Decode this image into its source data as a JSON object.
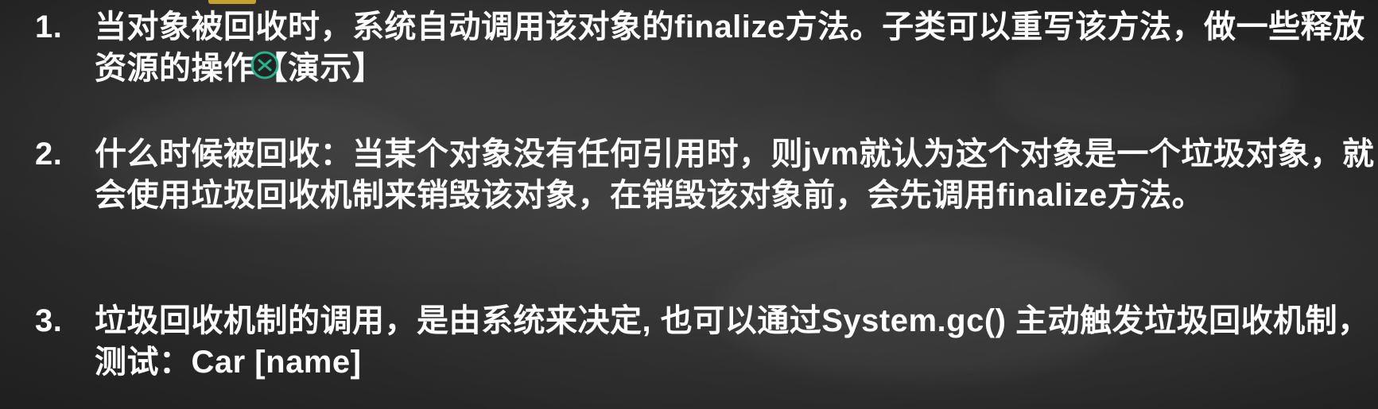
{
  "items": [
    {
      "number": "1.",
      "text": "当对象被回收时，系统自动调用该对象的finalize方法。子类可以重写该方法，做一些释放资源的操作【演示】"
    },
    {
      "number": "2.",
      "text": "什么时候被回收：当某个对象没有任何引用时，则jvm就认为这个对象是一个垃圾对象，就会使用垃圾回收机制来销毁该对象，在销毁该对象前，会先调用finalize方法。"
    },
    {
      "number": "3.",
      "text": "垃圾回收机制的调用，是由系统来决定, 也可以通过System.gc() 主动触发垃圾回收机制，测试：Car [name]"
    }
  ],
  "colors": {
    "text": "#ffffff",
    "background": "#2e2e2e",
    "accent": "#c7a22a",
    "cursor": "#25b58a"
  },
  "icons": {
    "cursor": "cursor-icon"
  }
}
